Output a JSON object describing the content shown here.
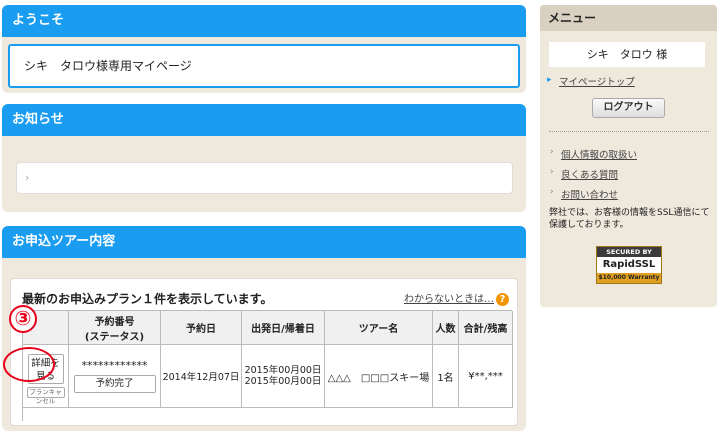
{
  "welcome": {
    "header": "ようこそ",
    "text": "シキ　タロウ様専用マイページ"
  },
  "news": {
    "header": "お知らせ",
    "arrow": "›"
  },
  "tour": {
    "header": "お申込ツアー内容",
    "title": "最新のお申込みプラン１件を表示しています。",
    "help_link": "わからないときは…",
    "help_icon": "?",
    "annotation_number": "③",
    "columns": [
      "",
      "予約番号\n(ステータス)",
      "予約日",
      "出発日/帰着日",
      "ツアー名",
      "人数",
      "合計/残高"
    ],
    "row": {
      "detail_button": "詳細を\n見る",
      "cancel_plan": "プランキャンセル",
      "reservation_number": "************",
      "status_button": "予約完了",
      "reservation_date": "2014年12月07日",
      "departure": "2015年00月00日",
      "return": "2015年00月00日",
      "tour_name": "△△△　□□□スキー場",
      "people": "1名",
      "total": "¥**,***"
    }
  },
  "sidebar": {
    "header": "メニュー",
    "user_name": "シキ　タロウ 様",
    "mypage_top": "マイページトップ",
    "logout": "ログアウト",
    "links": [
      "個人情報の取扱い",
      "良くある質問",
      "お問い合わせ"
    ],
    "ssl_note": "弊社では、お客様の情報をSSL通信にて保護しております。",
    "ssl_badge": {
      "line1": "SECURED BY",
      "line2": "RapidSSL",
      "line3": "$10,000 Warranty"
    }
  },
  "colors": {
    "accent": "#1a9cf0",
    "panel_bg": "#efe8dd",
    "annotation": "#e8001c"
  }
}
